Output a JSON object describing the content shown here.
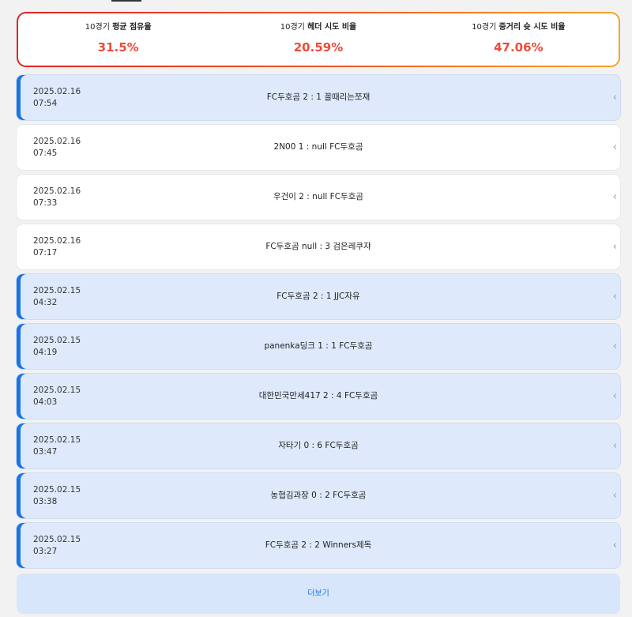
{
  "stats": [
    {
      "prefix": "10경기",
      "label": "평균 점유율",
      "value": "31.5%"
    },
    {
      "prefix": "10경기",
      "label": "헤더 시도 비율",
      "value": "20.59%"
    },
    {
      "prefix": "10경기",
      "label": "중거리 슛 시도 비율",
      "value": "47.06%"
    }
  ],
  "matches": [
    {
      "date": "2025.02.16",
      "time": "07:54",
      "score": "FC두호곰 2 : 1 꼴때리는쪼재",
      "result": "win"
    },
    {
      "date": "2025.02.16",
      "time": "07:45",
      "score": "2N00 1 : null FC두호곰",
      "result": "none"
    },
    {
      "date": "2025.02.16",
      "time": "07:33",
      "score": "우건이 2 : null FC두호곰",
      "result": "none"
    },
    {
      "date": "2025.02.16",
      "time": "07:17",
      "score": "FC두호곰 null : 3 검은레쿠쟈",
      "result": "none"
    },
    {
      "date": "2025.02.15",
      "time": "04:32",
      "score": "FC두호곰 2 : 1 JJC자유",
      "result": "win"
    },
    {
      "date": "2025.02.15",
      "time": "04:19",
      "score": "panenka딩크 1 : 1 FC두호곰",
      "result": "win"
    },
    {
      "date": "2025.02.15",
      "time": "04:03",
      "score": "대한민국만세417 2 : 4 FC두호곰",
      "result": "win"
    },
    {
      "date": "2025.02.15",
      "time": "03:47",
      "score": "자타기 0 : 6 FC두호곰",
      "result": "win"
    },
    {
      "date": "2025.02.15",
      "time": "03:38",
      "score": "농협김과장 0 : 2 FC두호곰",
      "result": "win"
    },
    {
      "date": "2025.02.15",
      "time": "03:27",
      "score": "FC두호곰 2 : 2 Winners제독",
      "result": "win"
    }
  ],
  "more_label": "더보기",
  "chevron": "‹",
  "colors": {
    "accent": "#1a73e8",
    "stat_value": "#ef4a3a",
    "row_highlight": "#deeafc"
  }
}
